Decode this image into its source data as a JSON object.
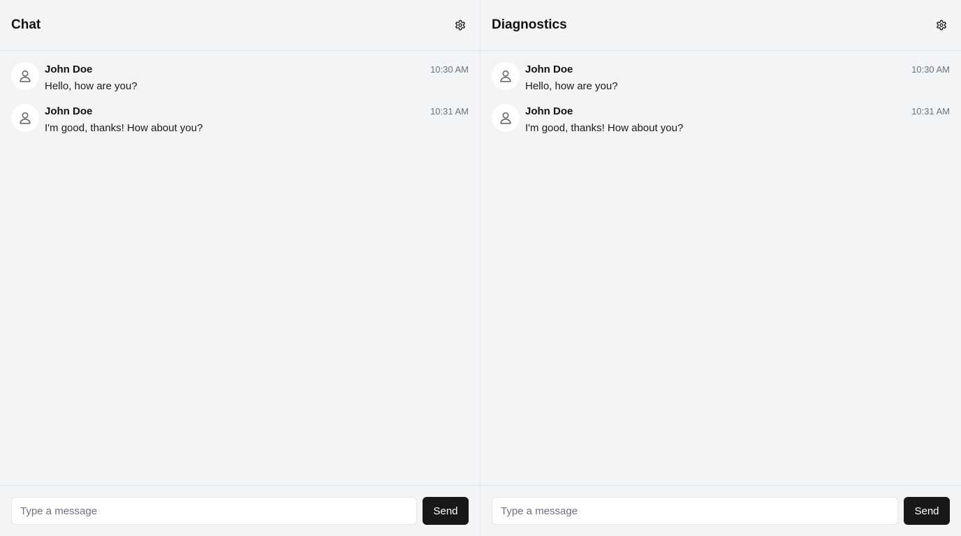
{
  "panels": [
    {
      "title": "Chat",
      "settings_icon": "gear-icon",
      "messages": [
        {
          "author": "John Doe",
          "time": "10:30 AM",
          "text": "Hello, how are you?",
          "avatar_icon": "user-icon"
        },
        {
          "author": "John Doe",
          "time": "10:31 AM",
          "text": "I'm good, thanks! How about you?",
          "avatar_icon": "user-icon"
        }
      ],
      "composer": {
        "placeholder": "Type a message",
        "value": "",
        "send_label": "Send"
      }
    },
    {
      "title": "Diagnostics",
      "settings_icon": "gear-icon",
      "messages": [
        {
          "author": "John Doe",
          "time": "10:30 AM",
          "text": "Hello, how are you?",
          "avatar_icon": "user-icon"
        },
        {
          "author": "John Doe",
          "time": "10:31 AM",
          "text": "I'm good, thanks! How about you?",
          "avatar_icon": "user-icon"
        }
      ],
      "composer": {
        "placeholder": "Type a message",
        "value": "",
        "send_label": "Send"
      }
    }
  ],
  "colors": {
    "background": "#f2f4f6",
    "border": "#e2e5e9",
    "avatar_bg": "#ffffff",
    "send_button": "#18181b",
    "muted_text": "#6b7280"
  }
}
